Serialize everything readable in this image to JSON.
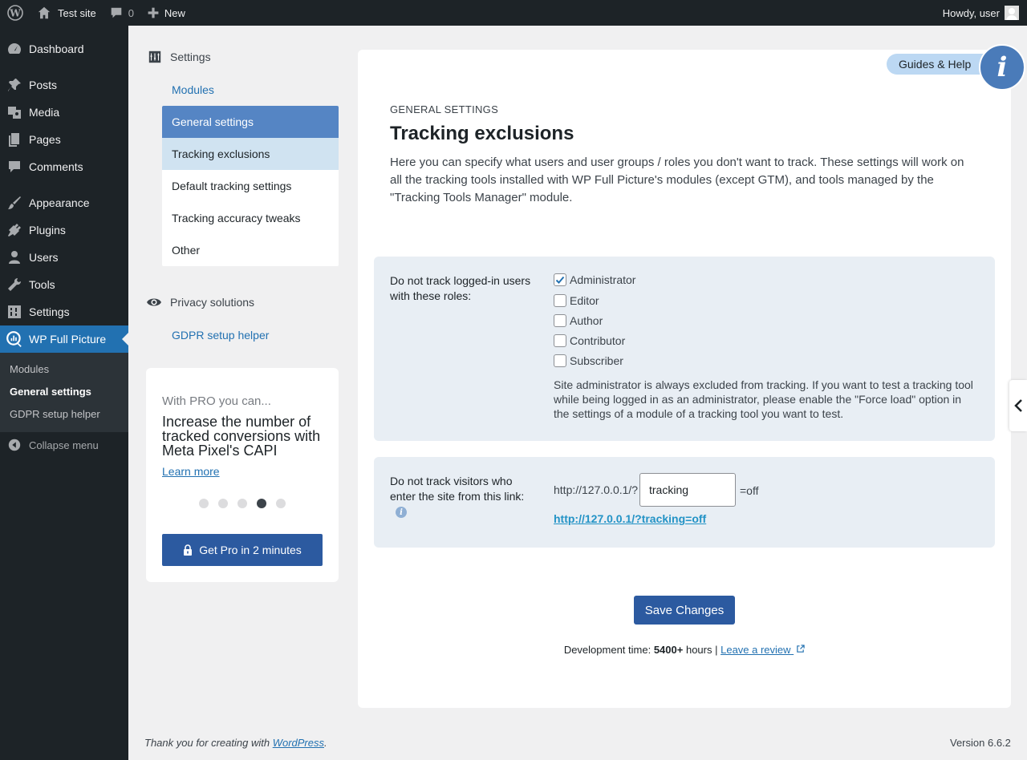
{
  "admin_bar": {
    "site_name": "Test site",
    "comments_count": "0",
    "new_label": "New",
    "greeting": "Howdy, user"
  },
  "admin_menu": {
    "items": [
      {
        "label": "Dashboard",
        "icon": "dashboard-icon"
      },
      {
        "label": "Posts",
        "icon": "pushpin-icon"
      },
      {
        "label": "Media",
        "icon": "media-icon"
      },
      {
        "label": "Pages",
        "icon": "pages-icon"
      },
      {
        "label": "Comments",
        "icon": "comment-icon"
      },
      {
        "label": "Appearance",
        "icon": "paintbrush-icon"
      },
      {
        "label": "Plugins",
        "icon": "plug-icon"
      },
      {
        "label": "Users",
        "icon": "user-icon"
      },
      {
        "label": "Tools",
        "icon": "wrench-icon"
      },
      {
        "label": "Settings",
        "icon": "settings-icon"
      },
      {
        "label": "WP Full Picture",
        "icon": "analytics-icon"
      }
    ],
    "submenu": [
      "Modules",
      "General settings",
      "GDPR setup helper"
    ],
    "collapse_label": "Collapse menu"
  },
  "plugin_nav": {
    "settings_heading": "Settings",
    "modules_link": "Modules",
    "general_settings": "General settings",
    "sub_items": [
      "Tracking exclusions",
      "Default tracking settings",
      "Tracking accuracy tweaks",
      "Other"
    ],
    "privacy_heading": "Privacy solutions",
    "gdpr_link": "GDPR setup helper"
  },
  "promo": {
    "lead": "With PRO you can...",
    "title": "Increase the number of tracked conversions with Meta Pixel's CAPI",
    "link": "Learn more",
    "active_slide": 4,
    "slide_count": 5,
    "button": "Get Pro in 2 minutes"
  },
  "main": {
    "guides_label": "Guides & Help",
    "info_glyph": "i",
    "section_label": "General settings",
    "title": "Tracking exclusions",
    "description": "Here you can specify what users and user groups / roles you don't want to track. These settings will work on all the tracking tools installed with WP Full Picture's modules (except GTM), and tools managed by the \"Tracking Tools Manager\" module.",
    "roles_field": {
      "label": "Do not track logged-in users with these roles:",
      "roles": [
        {
          "label": "Administrator",
          "checked": true
        },
        {
          "label": "Editor",
          "checked": false
        },
        {
          "label": "Author",
          "checked": false
        },
        {
          "label": "Contributor",
          "checked": false
        },
        {
          "label": "Subscriber",
          "checked": false
        }
      ],
      "note": "Site administrator is always excluded from tracking. If you want to test a tracking tool while being logged in as an administrator, please enable the \"Force load\" option in the settings of a module of a tracking tool you want to test."
    },
    "link_field": {
      "label": "Do not track visitors who enter the site from this link:",
      "prefix": "http://127.0.0.1/?",
      "value": "tracking",
      "suffix": "=off",
      "preview_link": "http://127.0.0.1/?tracking=off"
    },
    "save_label": "Save Changes",
    "dev_time_prefix": "Development time:",
    "dev_time_value": "5400+",
    "dev_time_suffix": "hours |",
    "review_link": "Leave a review"
  },
  "footer": {
    "thanks_prefix": "Thank you for creating with",
    "wordpress_link": "WordPress",
    "thanks_suffix": ".",
    "version": "Version 6.6.2"
  }
}
